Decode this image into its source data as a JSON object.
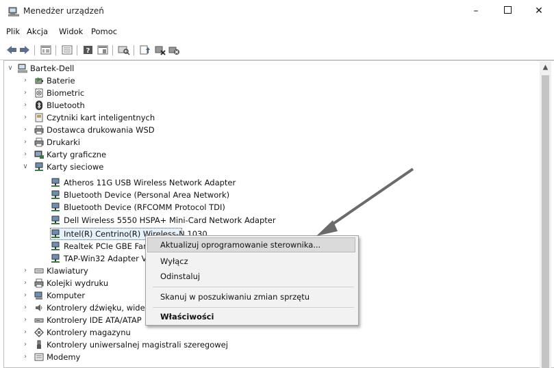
{
  "window": {
    "title": "Menedżer urządzeń",
    "minimize_label": "–",
    "close_label": "✕"
  },
  "menu": [
    "Plik",
    "Akcja",
    "Widok",
    "Pomoc"
  ],
  "tree": {
    "root": "Bartek-Dell",
    "categories_before": [
      "Baterie",
      "Biometric",
      "Bluetooth",
      "Czytniki kart inteligentnych",
      "Dostawca drukowania WSD",
      "Drukarki",
      "Karty graficzne"
    ],
    "expanded_category": "Karty sieciowe",
    "network_adapters": [
      "Atheros 11G USB Wireless Network Adapter",
      "Bluetooth Device (Personal Area Network)",
      "Bluetooth Device (RFCOMM Protocol TDI)",
      "Dell Wireless 5550 HSPA+ Mini-Card Network Adapter",
      "Intel(R) Centrino(R) Wireless-N 1030",
      "Realtek PCIe GBE Fam",
      "TAP-Win32 Adapter V"
    ],
    "categories_after": [
      "Klawiatury",
      "Kolejki wydruku",
      "Komputer",
      "Kontrolery dźwięku, wide",
      "Kontrolery IDE ATA/ATAP",
      "Kontrolery magazynu",
      "Kontrolery uniwersalnej magistrali szeregowej",
      "Modemy"
    ]
  },
  "context_menu": {
    "update_driver": "Aktualizuj oprogramowanie sterownika...",
    "disable": "Wyłącz",
    "uninstall": "Odinstaluj",
    "scan": "Skanuj w poszukiwaniu zmian sprzętu",
    "properties": "Właściwości"
  },
  "icons": {
    "app": "device-manager-icon",
    "toolbar": [
      "back-icon",
      "forward-icon",
      "view-icon",
      "list-icon",
      "help-icon",
      "properties-icon",
      "scan-icon",
      "update-driver-icon",
      "disable-icon",
      "uninstall-icon"
    ]
  },
  "colors": {
    "selection": "#e5f1fb",
    "menu_bg": "#f2f2f2",
    "arrow": "#6b6b6b"
  }
}
